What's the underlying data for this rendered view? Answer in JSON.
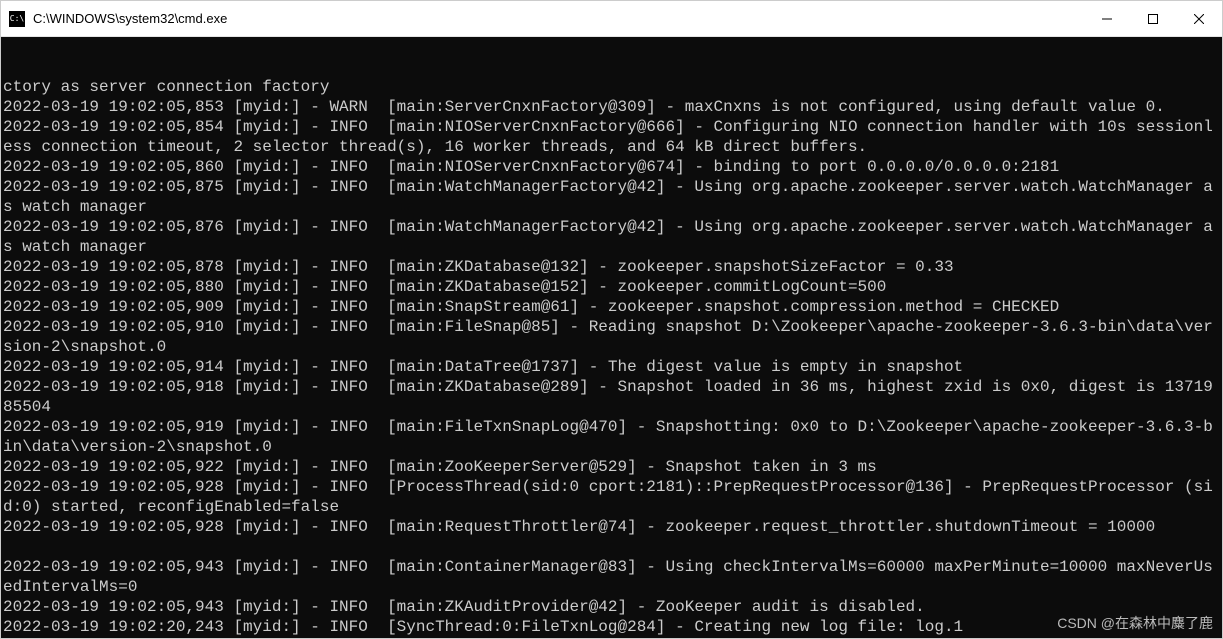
{
  "window": {
    "title": "C:\\WINDOWS\\system32\\cmd.exe",
    "icon_label": "C:\\"
  },
  "console": {
    "lines": [
      "ctory as server connection factory",
      "2022-03-19 19:02:05,853 [myid:] - WARN  [main:ServerCnxnFactory@309] - maxCnxns is not configured, using default value 0.",
      "2022-03-19 19:02:05,854 [myid:] - INFO  [main:NIOServerCnxnFactory@666] - Configuring NIO connection handler with 10s sessionless connection timeout, 2 selector thread(s), 16 worker threads, and 64 kB direct buffers.",
      "2022-03-19 19:02:05,860 [myid:] - INFO  [main:NIOServerCnxnFactory@674] - binding to port 0.0.0.0/0.0.0.0:2181",
      "2022-03-19 19:02:05,875 [myid:] - INFO  [main:WatchManagerFactory@42] - Using org.apache.zookeeper.server.watch.WatchManager as watch manager",
      "2022-03-19 19:02:05,876 [myid:] - INFO  [main:WatchManagerFactory@42] - Using org.apache.zookeeper.server.watch.WatchManager as watch manager",
      "2022-03-19 19:02:05,878 [myid:] - INFO  [main:ZKDatabase@132] - zookeeper.snapshotSizeFactor = 0.33",
      "2022-03-19 19:02:05,880 [myid:] - INFO  [main:ZKDatabase@152] - zookeeper.commitLogCount=500",
      "2022-03-19 19:02:05,909 [myid:] - INFO  [main:SnapStream@61] - zookeeper.snapshot.compression.method = CHECKED",
      "2022-03-19 19:02:05,910 [myid:] - INFO  [main:FileSnap@85] - Reading snapshot D:\\Zookeeper\\apache-zookeeper-3.6.3-bin\\data\\version-2\\snapshot.0",
      "2022-03-19 19:02:05,914 [myid:] - INFO  [main:DataTree@1737] - The digest value is empty in snapshot",
      "2022-03-19 19:02:05,918 [myid:] - INFO  [main:ZKDatabase@289] - Snapshot loaded in 36 ms, highest zxid is 0x0, digest is 1371985504",
      "2022-03-19 19:02:05,919 [myid:] - INFO  [main:FileTxnSnapLog@470] - Snapshotting: 0x0 to D:\\Zookeeper\\apache-zookeeper-3.6.3-bin\\data\\version-2\\snapshot.0",
      "2022-03-19 19:02:05,922 [myid:] - INFO  [main:ZooKeeperServer@529] - Snapshot taken in 3 ms",
      "2022-03-19 19:02:05,928 [myid:] - INFO  [ProcessThread(sid:0 cport:2181)::PrepRequestProcessor@136] - PrepRequestProcessor (sid:0) started, reconfigEnabled=false",
      "2022-03-19 19:02:05,928 [myid:] - INFO  [main:RequestThrottler@74] - zookeeper.request_throttler.shutdownTimeout = 10000",
      "",
      "2022-03-19 19:02:05,943 [myid:] - INFO  [main:ContainerManager@83] - Using checkIntervalMs=60000 maxPerMinute=10000 maxNeverUsedIntervalMs=0",
      "2022-03-19 19:02:05,943 [myid:] - INFO  [main:ZKAuditProvider@42] - ZooKeeper audit is disabled.",
      "2022-03-19 19:02:20,243 [myid:] - INFO  [SyncThread:0:FileTxnLog@284] - Creating new log file: log.1"
    ]
  },
  "watermark": {
    "text": "CSDN @在森林中麋了鹿"
  }
}
